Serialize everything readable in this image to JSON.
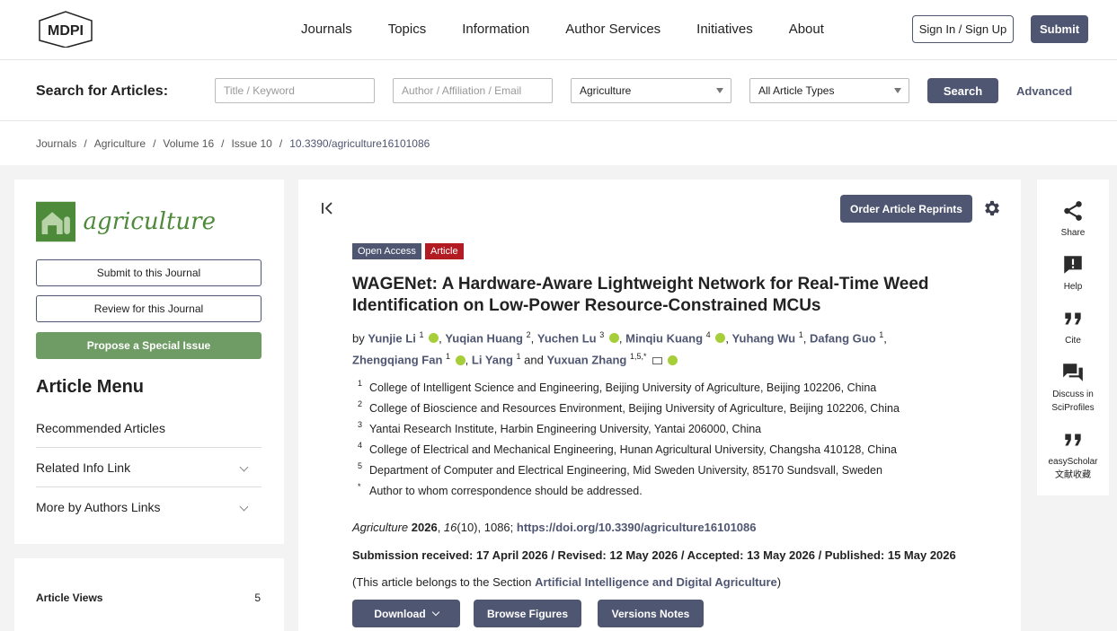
{
  "header": {
    "logo_text": "MDPI",
    "nav": [
      "Journals",
      "Topics",
      "Information",
      "Author Services",
      "Initiatives",
      "About"
    ],
    "signin_label": "Sign In / Sign Up",
    "submit_label": "Submit"
  },
  "search": {
    "title": "Search for Articles:",
    "keyword_placeholder": "Title / Keyword",
    "author_placeholder": "Author / Affiliation / Email",
    "journal_selected": "Agriculture",
    "type_selected": "All Article Types",
    "search_label": "Search",
    "advanced_label": "Advanced"
  },
  "breadcrumb": [
    "Journals",
    "Agriculture",
    "Volume 16",
    "Issue 10",
    "10.3390/agriculture16101086"
  ],
  "sidebar": {
    "journal_name": "agriculture",
    "submit_label": "Submit to this Journal",
    "review_label": "Review for this Journal",
    "propose_label": "Propose a Special Issue",
    "menu_title": "Article Menu",
    "menu_items": [
      "Recommended Articles",
      "Related Info Link",
      "More by Authors Links"
    ],
    "views_label": "Article Views",
    "views_count": "5"
  },
  "article": {
    "reprints_label": "Order Article Reprints",
    "badge_open": "Open Access",
    "badge_type": "Article",
    "title": "WAGENet: A Hardware-Aware Lightweight Network for Real-Time Weed Identification on Low-Power Resource-Constrained MCUs",
    "by": "by",
    "authors": [
      {
        "name": "Yunjie Li",
        "sup": "1"
      },
      {
        "name": "Yuqian Huang",
        "sup": "2"
      },
      {
        "name": "Yuchen Lu",
        "sup": "3"
      },
      {
        "name": "Minqiu Kuang",
        "sup": "4"
      },
      {
        "name": "Yuhang Wu",
        "sup": "1"
      },
      {
        "name": "Dafang Guo",
        "sup": "1"
      },
      {
        "name": "Zhengqiang Fan",
        "sup": "1"
      },
      {
        "name": "Li Yang",
        "sup": "1"
      },
      {
        "name": "Yuxuan Zhang",
        "sup": "1,5,*"
      }
    ],
    "and_text": "and",
    "affiliations": [
      {
        "num": "1",
        "text": "College of Intelligent Science and Engineering, Beijing University of Agriculture, Beijing 102206, China"
      },
      {
        "num": "2",
        "text": "College of Bioscience and Resources Environment, Beijing University of Agriculture, Beijing 102206, China"
      },
      {
        "num": "3",
        "text": "Yantai Research Institute, Harbin Engineering University, Yantai 206000, China"
      },
      {
        "num": "4",
        "text": "College of Electrical and Mechanical Engineering, Hunan Agricultural University, Changsha 410128, China"
      },
      {
        "num": "5",
        "text": "Department of Computer and Electrical Engineering, Mid Sweden University, 85170 Sundsvall, Sweden"
      },
      {
        "num": "*",
        "text": "Author to whom correspondence should be addressed."
      }
    ],
    "citation_journal": "Agriculture",
    "citation_year": "2026",
    "citation_volume": "16",
    "citation_rest": "(10), 1086;",
    "doi": "https://doi.org/10.3390/agriculture16101086",
    "dates": "Submission received: 17 April 2026 / Revised: 12 May 2026 / Accepted: 13 May 2026 / Published: 15 May 2026",
    "section_prefix": "(This article belongs to the Section",
    "section_name": "Artificial Intelligence and Digital Agriculture",
    "section_suffix": ")",
    "download_label": "Download",
    "figures_label": "Browse Figures",
    "versions_label": "Versions Notes"
  },
  "tools": {
    "share": "Share",
    "help": "Help",
    "cite": "Cite",
    "discuss_line1": "Discuss in",
    "discuss_line2": "SciProfiles",
    "easyscholar_line1": "easyScholar",
    "easyscholar_line2": "文献收藏"
  },
  "colors": {
    "accent": "#4f5671",
    "article_badge": "#b21b22",
    "journal_green": "#4d8a3a",
    "propose_green": "#6f9c65",
    "orcid": "#a6ce39"
  }
}
